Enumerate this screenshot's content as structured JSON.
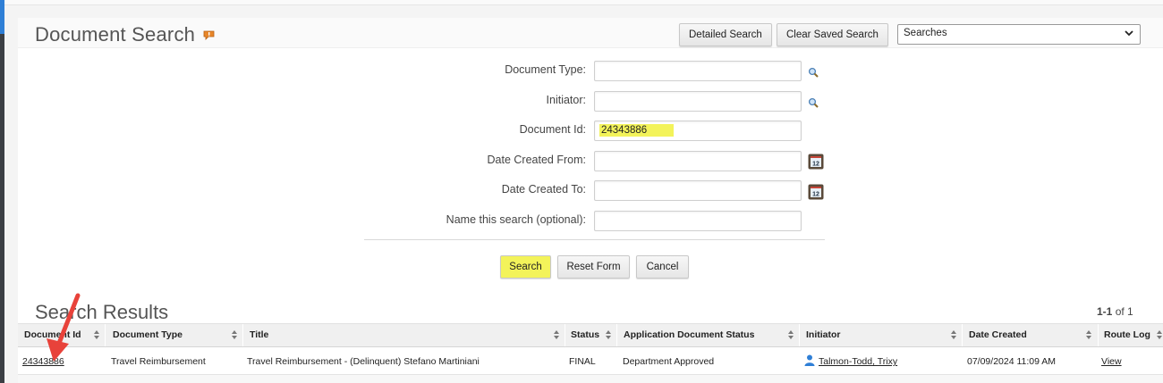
{
  "page": {
    "title": "Document Search"
  },
  "header": {
    "detailed_search_label": "Detailed Search",
    "clear_saved_search_label": "Clear Saved Search",
    "searches_select_value": "Searches"
  },
  "form": {
    "document_type_label": "Document Type:",
    "document_type_value": "",
    "initiator_label": "Initiator:",
    "initiator_value": "",
    "document_id_label": "Document Id:",
    "document_id_value": "24343886",
    "date_created_from_label": "Date Created From:",
    "date_created_from_value": "",
    "date_created_to_label": "Date Created To:",
    "date_created_to_value": "",
    "name_search_label": "Name this search (optional):",
    "name_search_value": "",
    "search_button": "Search",
    "reset_button": "Reset Form",
    "cancel_button": "Cancel"
  },
  "results": {
    "title": "Search Results",
    "count_range": "1-1",
    "count_of": "of 1",
    "columns": [
      "Document Id",
      "Document Type",
      "Title",
      "Status",
      "Application Document Status",
      "Initiator",
      "Date Created",
      "Route Log"
    ],
    "rows": [
      {
        "document_id": "24343886",
        "document_type": "Travel Reimbursement",
        "title": "Travel Reimbursement - (Delinquent) Stefano Martiniani",
        "status": "FINAL",
        "app_doc_status": "Department Approved",
        "initiator": "Talmon-Todd, Trixy",
        "date_created": "07/09/2024 11:09 AM",
        "route_log": "View"
      }
    ]
  },
  "colors": {
    "highlight": "#f3f35a",
    "arrow": "#e8423a",
    "user_icon": "#2f7fd6"
  },
  "icons": [
    "help-icon",
    "lookup-icon",
    "calendar-icon",
    "sort-icon",
    "user-icon",
    "chevron-down-icon"
  ]
}
